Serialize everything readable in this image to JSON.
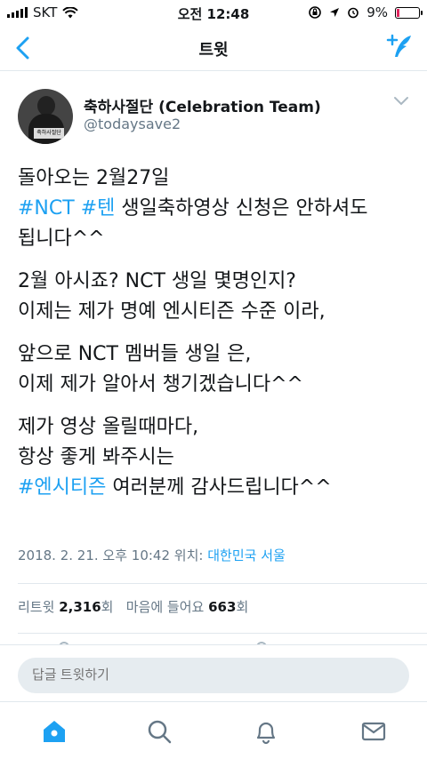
{
  "status_bar": {
    "carrier": "SKT",
    "time": "오전 12:48",
    "battery": "9%"
  },
  "nav": {
    "title": "트윗",
    "icons": [
      "back-chevron-icon",
      "compose-tweet-icon"
    ]
  },
  "tweet": {
    "author_name": "축하사절단 (Celebration Team)",
    "handle": "@todaysave2",
    "avatar_sign": "축하사절단",
    "paragraphs": [
      {
        "lines": [
          {
            "text": "돌아오는 2월27일"
          },
          {
            "hashtags": [
              "#NCT",
              "#텐"
            ],
            "rest": "생일축하영상 신청은  안하셔도"
          },
          {
            "text": "됩니다^^"
          }
        ]
      },
      {
        "lines": [
          {
            "text": "2월 아시죠? NCT 생일 몇명인지?"
          },
          {
            "text": "이제는 제가 명예 엔시티즌 수준 이라,"
          }
        ]
      },
      {
        "lines": [
          {
            "text": "앞으로 NCT 멤버들 생일 은,"
          },
          {
            "text": "이제 제가 알아서 챙기겠습니다^^"
          }
        ]
      },
      {
        "lines": [
          {
            "text": "제가 영상 올릴때마다,"
          },
          {
            "text": "항상 좋게 봐주시는"
          },
          {
            "hashtags": [
              "#엔시티즌"
            ],
            "rest": "여러분께 감사드립니다^^"
          }
        ]
      }
    ],
    "timestamp": "2018. 2. 21. 오후 10:42",
    "location_label": "위치:",
    "location": "대한민국 서울",
    "retweet_label": "리트윗",
    "retweet_count": "2,316",
    "retweet_unit": "회",
    "like_label": "마음에 들어요",
    "like_count": "663",
    "like_unit": "회"
  },
  "reply": {
    "placeholder": "답글 트윗하기"
  },
  "tabbar": {
    "items": [
      "home-icon",
      "search-icon",
      "notifications-icon",
      "messages-icon"
    ],
    "accent": "#1da1f2"
  }
}
